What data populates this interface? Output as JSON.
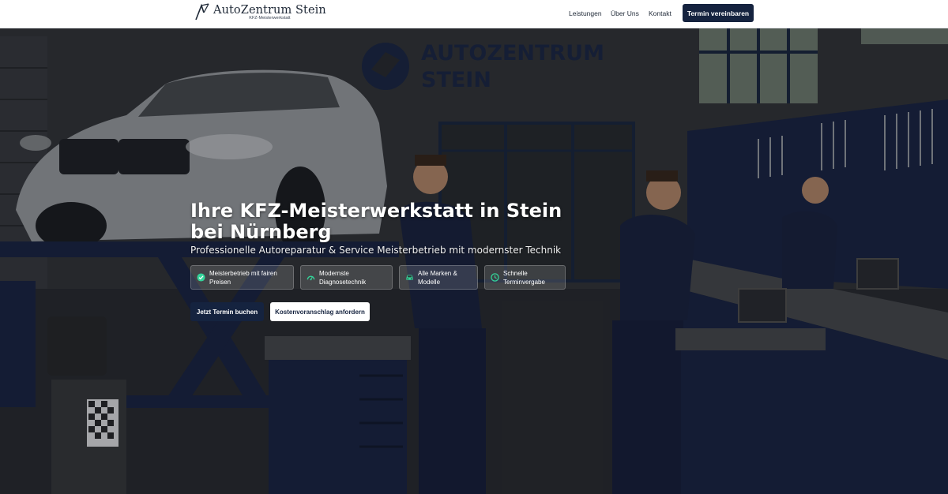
{
  "brand": {
    "name": "AutoZentrum Stein",
    "tagline": "KFZ-Meisterwerkstatt",
    "logo_icon": "stylized-arrow-logo-icon"
  },
  "nav": {
    "items": [
      "Leistungen",
      "Über Uns",
      "Kontakt"
    ],
    "cta_label": "Termin vereinbaren"
  },
  "hero": {
    "title": "Ihre KFZ-Meisterwerkstatt in Stein bei Nürnberg",
    "subtitle": "Professionelle Autoreparatur & Service Meisterbetrieb mit modernster Technik",
    "background_sign": [
      "AUTOZENTRUM",
      "STEIN"
    ],
    "features": [
      {
        "icon": "check-circle-icon",
        "label": "Meisterbetrieb mit fairen Preisen"
      },
      {
        "icon": "gauge-icon",
        "label": "Modernste Diagnosetechnik"
      },
      {
        "icon": "car-icon",
        "label": "Alle Marken & Modelle"
      },
      {
        "icon": "clock-icon",
        "label": "Schnelle Terminvergabe"
      }
    ],
    "buttons": {
      "primary": "Jetzt Termin buchen",
      "secondary": "Kostenvoranschlag anfordern"
    }
  },
  "colors": {
    "brand_navy": "#15233f",
    "icon_green": "#34d399",
    "header_bg": "#ffffff"
  }
}
